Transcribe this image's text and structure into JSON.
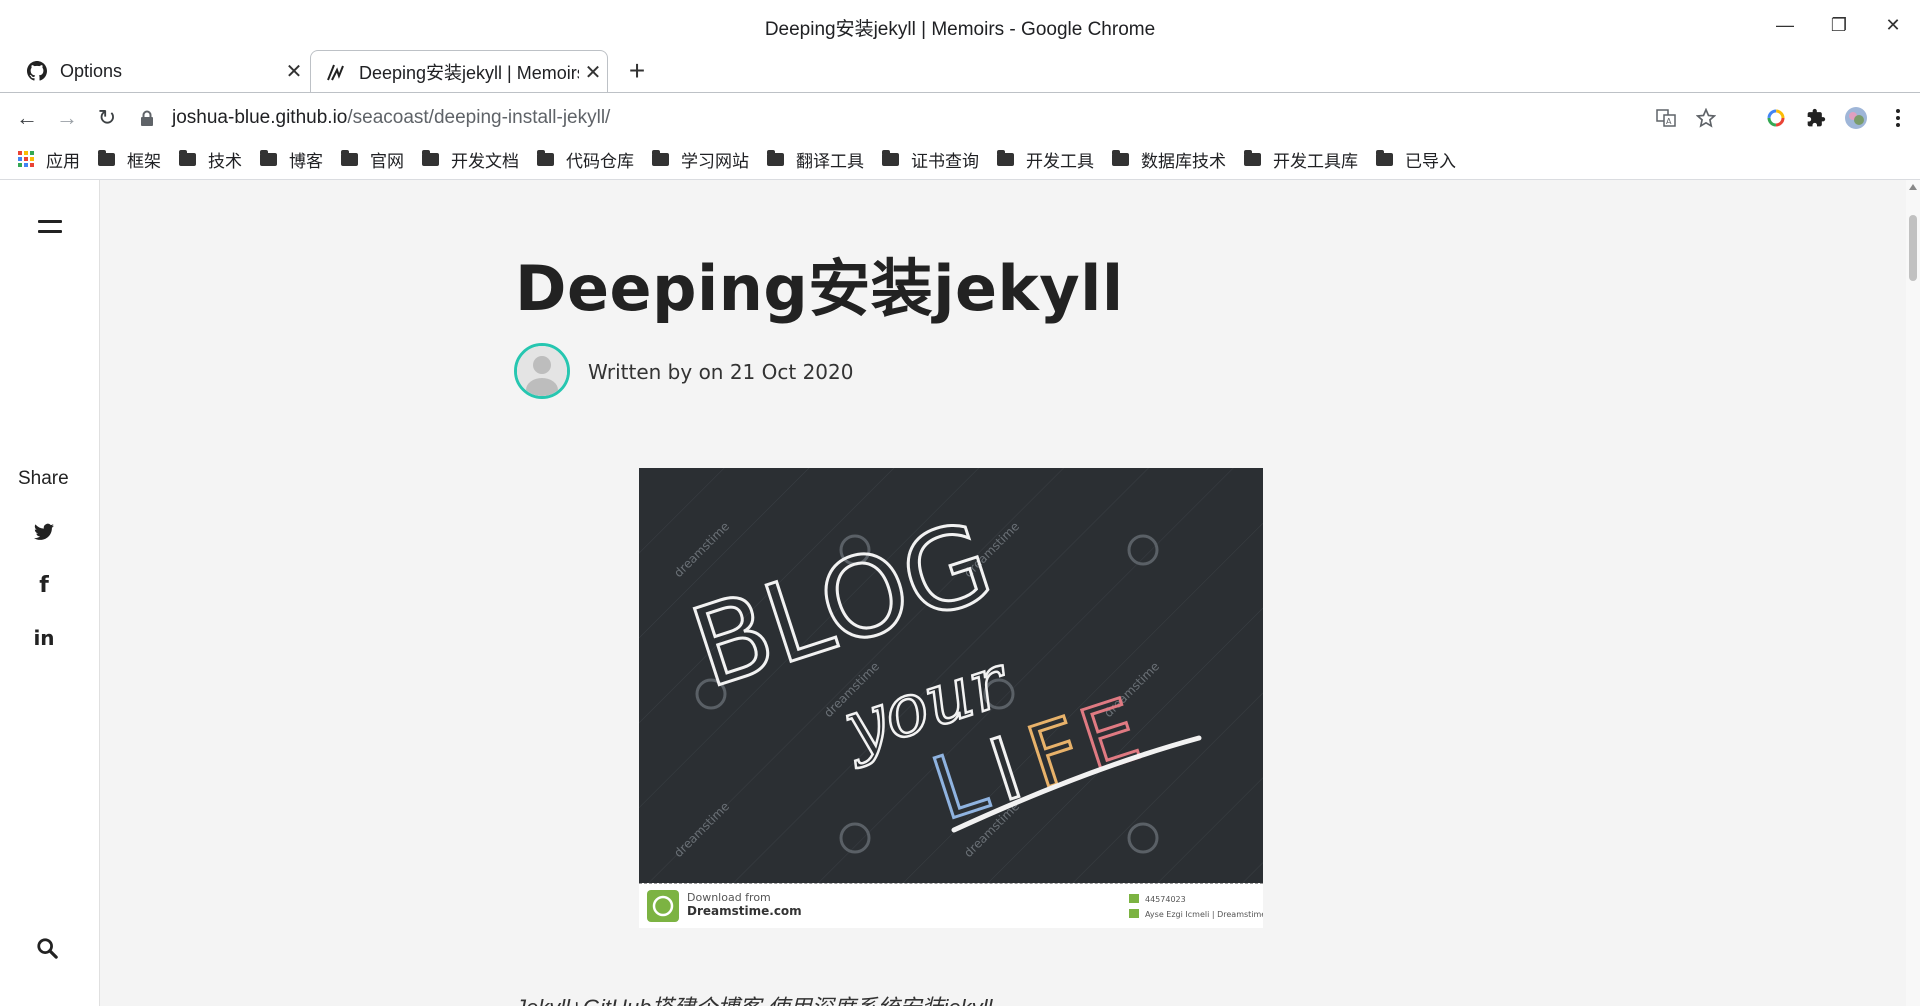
{
  "window": {
    "title": "Deeping安装jekyll | Memoirs - Google Chrome",
    "minimize": "—",
    "restore": "❐",
    "close": "✕"
  },
  "tabs": [
    {
      "label": "Options",
      "icon": "github-icon"
    },
    {
      "label": "Deeping安装jekyll | Memoirs",
      "icon": "site-logo-icon"
    }
  ],
  "tab_close": "✕",
  "new_tab": "+",
  "toolbar": {
    "back": "←",
    "forward": "→",
    "reload": "↻",
    "url_host": "joshua-blue.github.io",
    "url_path": "/seacoast/deeping-install-jekyll/"
  },
  "bookmarks": [
    {
      "label": "应用",
      "icon": "apps-grid-icon"
    },
    {
      "label": "框架",
      "icon": "folder-icon"
    },
    {
      "label": "技术",
      "icon": "folder-icon"
    },
    {
      "label": "博客",
      "icon": "folder-icon"
    },
    {
      "label": "官网",
      "icon": "folder-icon"
    },
    {
      "label": "开发文档",
      "icon": "folder-icon"
    },
    {
      "label": "代码仓库",
      "icon": "folder-icon"
    },
    {
      "label": "学习网站",
      "icon": "folder-icon"
    },
    {
      "label": "翻译工具",
      "icon": "folder-icon"
    },
    {
      "label": "证书查询",
      "icon": "folder-icon"
    },
    {
      "label": "开发工具",
      "icon": "folder-icon"
    },
    {
      "label": "数据库技术",
      "icon": "folder-icon"
    },
    {
      "label": "开发工具库",
      "icon": "folder-icon"
    },
    {
      "label": "已导入",
      "icon": "folder-icon"
    }
  ],
  "sidebar": {
    "share_label": "Share",
    "social": [
      {
        "name": "twitter-icon"
      },
      {
        "name": "facebook-icon",
        "glyph": "f"
      },
      {
        "name": "linkedin-icon",
        "glyph": "in"
      }
    ]
  },
  "post": {
    "title": "Deeping安装jekyll",
    "byline": "Written by on 21 Oct 2020",
    "hero": {
      "line1": "BLOG",
      "line2": "your",
      "line3": "LIFE",
      "watermark": "dreamstime",
      "footer_line1": "Download from",
      "footer_line2": "Dreamstime.com",
      "footer_id": "44574023",
      "footer_credit": "Ayse Ezgi Icmeli | Dreamstime.com"
    },
    "intro": "Jekyll+GitHub搭建个博客 使用深度系统安装jekyll"
  },
  "colors": {
    "accent": "#26c6b0",
    "content_bg": "#f4f4f4",
    "chalkboard": "#2b2f33"
  }
}
